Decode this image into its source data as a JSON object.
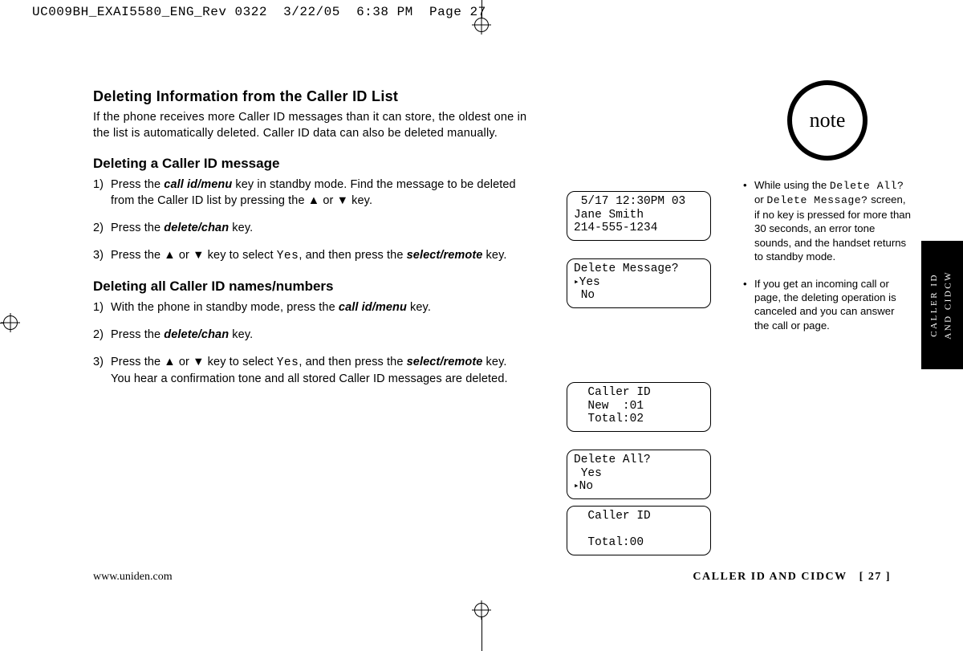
{
  "header": "UC009BH_EXAI5580_ENG_Rev 0322  3/22/05  6:38 PM  Page 27",
  "h_main": "Deleting Information from the Caller ID List",
  "intro": "If the phone receives more Caller ID messages than it can store, the oldest one in the list is automatically deleted. Caller ID data can also be deleted manually.",
  "h_sub1": "Deleting a Caller ID message",
  "s1_1a": "Press the ",
  "s1_1_key": "call id/menu",
  "s1_1b": " key in standby mode. Find the message to be deleted from the Caller ID list by pressing the ",
  "s1_1c": " or ",
  "s1_1d": " key.",
  "s1_2a": "Press the ",
  "s1_2_key": "delete/chan",
  "s1_2b": " key.",
  "s1_3a": "Press the ",
  "s1_3b": " or ",
  "s1_3c": " key to select ",
  "s1_3_yes": "Yes",
  "s1_3d": ", and then press the ",
  "s1_3_key": "select/remote",
  "s1_3e": " key.",
  "h_sub2": "Deleting all Caller ID names/numbers",
  "s2_1a": "With the phone in standby mode, press the ",
  "s2_1_key": "call id/menu",
  "s2_1b": " key.",
  "s2_2a": "Press the ",
  "s2_2_key": "delete/chan",
  "s2_2b": " key.",
  "s2_3a": "Press the ",
  "s2_3b": " or ",
  "s2_3c": " key to select ",
  "s2_3_yes": "Yes",
  "s2_3d": ", and then press the ",
  "s2_3_key": "select/remote",
  "s2_3e": " key.",
  "s2_3f": "You hear a confirmation tone and all stored Caller ID messages are deleted.",
  "lcd1": " 5/17 12:30PM 03\nJane Smith\n214-555-1234",
  "lcd2_l1": "Delete Message?",
  "lcd2_l2": "Yes",
  "lcd2_l3": " No",
  "lcd3": "  Caller ID\n  New  :01\n  Total:02",
  "lcd4_l1": "Delete All?",
  "lcd4_l2": " Yes",
  "lcd4_l3": "No",
  "lcd5": "  Caller ID\n\n  Total:00",
  "note_label": "note",
  "note1a": "While using the ",
  "note1_s1": "Delete All?",
  "note1b": " or ",
  "note1_s2": "Delete Message?",
  "note1c": " screen, if no key is pressed for more than 30 seconds, an error tone sounds, and the handset returns to standby mode.",
  "note2": "If you get an incoming call or page, the deleting operation is canceled and you can answer the call or page.",
  "tab_l1": "CALLER ID",
  "tab_l2": "AND CIDCW",
  "footer_url": "www.uniden.com",
  "footer_section": "CALLER ID AND CIDCW",
  "footer_page": "[ 27 ]",
  "tri_up": "▲",
  "tri_down": "▼"
}
